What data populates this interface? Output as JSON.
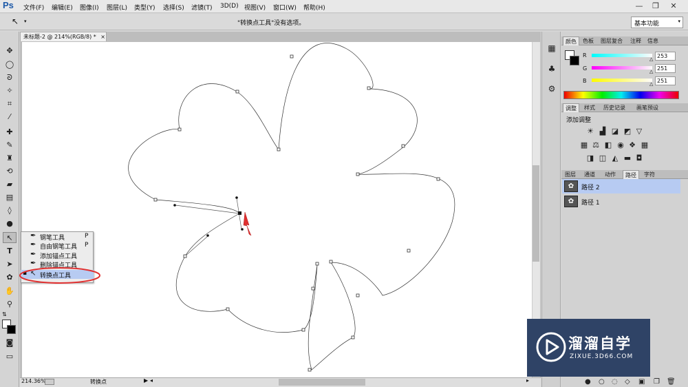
{
  "app": {
    "logo": "Ps"
  },
  "menu": [
    "文件(F)",
    "编辑(E)",
    "图像(I)",
    "图层(L)",
    "类型(Y)",
    "选择(S)",
    "滤镜(T)",
    "3D(D)",
    "视图(V)",
    "窗口(W)",
    "帮助(H)"
  ],
  "window_controls": {
    "minimize": "—",
    "restore": "❐",
    "close": "✕"
  },
  "options": {
    "tool_glyph": "↖",
    "message": "\"转换点工具\"没有选项。",
    "workspace": "基本功能"
  },
  "document": {
    "tab_title": "未标题-2 @ 214%(RGB/8) *",
    "zoom": "214.36%",
    "status": "转换点"
  },
  "flyout": {
    "items": [
      {
        "label": "钢笔工具",
        "shortcut": "P"
      },
      {
        "label": "自由钢笔工具",
        "shortcut": "P"
      },
      {
        "label": "添加锚点工具",
        "shortcut": ""
      },
      {
        "label": "删除锚点工具",
        "shortcut": ""
      },
      {
        "label": "转换点工具",
        "shortcut": ""
      }
    ],
    "selected_index": 4,
    "highlight_color": "#e03030"
  },
  "color_panel": {
    "tabs": [
      "颜色",
      "色板",
      "图层复合",
      "注释",
      "信息"
    ],
    "channels": [
      {
        "label": "R",
        "value": "253"
      },
      {
        "label": "G",
        "value": "251"
      },
      {
        "label": "B",
        "value": "251"
      }
    ]
  },
  "adjust_panel": {
    "tabs": [
      "调整",
      "样式",
      "历史记录",
      "画笔预设"
    ],
    "title": "添加调整"
  },
  "layers_panel": {
    "tabs": [
      "图层",
      "通道",
      "动作",
      "路径",
      "字符"
    ],
    "paths": [
      {
        "name": "路径 2",
        "selected": true
      },
      {
        "name": "路径 1",
        "selected": false
      }
    ]
  },
  "watermark": {
    "brand": "溜溜自学",
    "url": "ZIXUE.3D66.COM"
  },
  "colors": {
    "accent_red": "#e03030",
    "selection_blue": "#b7cbf2",
    "watermark_bg": "#2f4366"
  }
}
